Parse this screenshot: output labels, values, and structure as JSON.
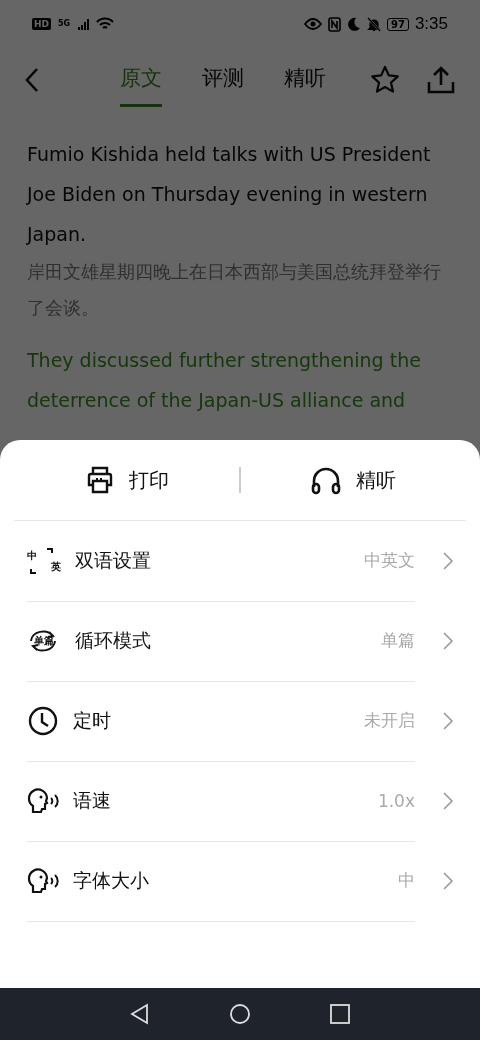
{
  "status_bar": {
    "badges": [
      "HD",
      "5G"
    ],
    "battery": "97",
    "time": "3:35"
  },
  "header": {
    "tabs": [
      {
        "label": "原文",
        "selected": true
      },
      {
        "label": "评测",
        "selected": false
      },
      {
        "label": "精听",
        "selected": false
      }
    ]
  },
  "article": [
    {
      "kind": "en",
      "text": "Fumio Kishida held talks with US President Joe Biden on Thursday evening in western Japan.",
      "highlighted": false
    },
    {
      "kind": "zh",
      "text": "岸田文雄星期四晚上在日本西部与美国总统拜登举行了会谈。",
      "highlighted": false
    },
    {
      "kind": "en",
      "text": "They discussed further strengthening the deterrence of the Japan-US alliance and",
      "highlighted": true
    }
  ],
  "sheet": {
    "actions": [
      {
        "kind": "print",
        "label": "打印"
      },
      {
        "kind": "headphones",
        "label": "精听"
      }
    ],
    "items": [
      {
        "kind": "bilingual",
        "icon_text": [
          "中",
          "英"
        ],
        "label": "双语设置",
        "value": "中英文"
      },
      {
        "kind": "loop",
        "icon_text": [
          "单篇"
        ],
        "label": "循环模式",
        "value": "单篇"
      },
      {
        "kind": "clock",
        "label": "定时",
        "value": "未开启"
      },
      {
        "kind": "speech",
        "label": "语速",
        "value": "1.0x"
      },
      {
        "kind": "speech",
        "label": "字体大小",
        "value": "中"
      }
    ]
  }
}
